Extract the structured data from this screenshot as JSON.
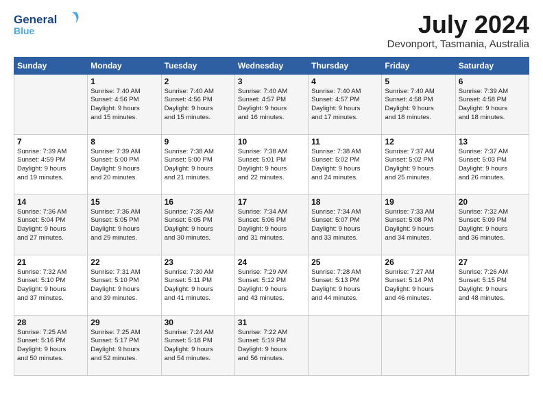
{
  "header": {
    "logo_general": "General",
    "logo_blue": "Blue",
    "title": "July 2024",
    "location": "Devonport, Tasmania, Australia"
  },
  "days_of_week": [
    "Sunday",
    "Monday",
    "Tuesday",
    "Wednesday",
    "Thursday",
    "Friday",
    "Saturday"
  ],
  "weeks": [
    [
      {
        "day": "",
        "lines": []
      },
      {
        "day": "1",
        "lines": [
          "Sunrise: 7:40 AM",
          "Sunset: 4:56 PM",
          "Daylight: 9 hours",
          "and 15 minutes."
        ]
      },
      {
        "day": "2",
        "lines": [
          "Sunrise: 7:40 AM",
          "Sunset: 4:56 PM",
          "Daylight: 9 hours",
          "and 15 minutes."
        ]
      },
      {
        "day": "3",
        "lines": [
          "Sunrise: 7:40 AM",
          "Sunset: 4:57 PM",
          "Daylight: 9 hours",
          "and 16 minutes."
        ]
      },
      {
        "day": "4",
        "lines": [
          "Sunrise: 7:40 AM",
          "Sunset: 4:57 PM",
          "Daylight: 9 hours",
          "and 17 minutes."
        ]
      },
      {
        "day": "5",
        "lines": [
          "Sunrise: 7:40 AM",
          "Sunset: 4:58 PM",
          "Daylight: 9 hours",
          "and 18 minutes."
        ]
      },
      {
        "day": "6",
        "lines": [
          "Sunrise: 7:39 AM",
          "Sunset: 4:58 PM",
          "Daylight: 9 hours",
          "and 18 minutes."
        ]
      }
    ],
    [
      {
        "day": "7",
        "lines": [
          "Sunrise: 7:39 AM",
          "Sunset: 4:59 PM",
          "Daylight: 9 hours",
          "and 19 minutes."
        ]
      },
      {
        "day": "8",
        "lines": [
          "Sunrise: 7:39 AM",
          "Sunset: 5:00 PM",
          "Daylight: 9 hours",
          "and 20 minutes."
        ]
      },
      {
        "day": "9",
        "lines": [
          "Sunrise: 7:38 AM",
          "Sunset: 5:00 PM",
          "Daylight: 9 hours",
          "and 21 minutes."
        ]
      },
      {
        "day": "10",
        "lines": [
          "Sunrise: 7:38 AM",
          "Sunset: 5:01 PM",
          "Daylight: 9 hours",
          "and 22 minutes."
        ]
      },
      {
        "day": "11",
        "lines": [
          "Sunrise: 7:38 AM",
          "Sunset: 5:02 PM",
          "Daylight: 9 hours",
          "and 24 minutes."
        ]
      },
      {
        "day": "12",
        "lines": [
          "Sunrise: 7:37 AM",
          "Sunset: 5:02 PM",
          "Daylight: 9 hours",
          "and 25 minutes."
        ]
      },
      {
        "day": "13",
        "lines": [
          "Sunrise: 7:37 AM",
          "Sunset: 5:03 PM",
          "Daylight: 9 hours",
          "and 26 minutes."
        ]
      }
    ],
    [
      {
        "day": "14",
        "lines": [
          "Sunrise: 7:36 AM",
          "Sunset: 5:04 PM",
          "Daylight: 9 hours",
          "and 27 minutes."
        ]
      },
      {
        "day": "15",
        "lines": [
          "Sunrise: 7:36 AM",
          "Sunset: 5:05 PM",
          "Daylight: 9 hours",
          "and 29 minutes."
        ]
      },
      {
        "day": "16",
        "lines": [
          "Sunrise: 7:35 AM",
          "Sunset: 5:05 PM",
          "Daylight: 9 hours",
          "and 30 minutes."
        ]
      },
      {
        "day": "17",
        "lines": [
          "Sunrise: 7:34 AM",
          "Sunset: 5:06 PM",
          "Daylight: 9 hours",
          "and 31 minutes."
        ]
      },
      {
        "day": "18",
        "lines": [
          "Sunrise: 7:34 AM",
          "Sunset: 5:07 PM",
          "Daylight: 9 hours",
          "and 33 minutes."
        ]
      },
      {
        "day": "19",
        "lines": [
          "Sunrise: 7:33 AM",
          "Sunset: 5:08 PM",
          "Daylight: 9 hours",
          "and 34 minutes."
        ]
      },
      {
        "day": "20",
        "lines": [
          "Sunrise: 7:32 AM",
          "Sunset: 5:09 PM",
          "Daylight: 9 hours",
          "and 36 minutes."
        ]
      }
    ],
    [
      {
        "day": "21",
        "lines": [
          "Sunrise: 7:32 AM",
          "Sunset: 5:10 PM",
          "Daylight: 9 hours",
          "and 37 minutes."
        ]
      },
      {
        "day": "22",
        "lines": [
          "Sunrise: 7:31 AM",
          "Sunset: 5:10 PM",
          "Daylight: 9 hours",
          "and 39 minutes."
        ]
      },
      {
        "day": "23",
        "lines": [
          "Sunrise: 7:30 AM",
          "Sunset: 5:11 PM",
          "Daylight: 9 hours",
          "and 41 minutes."
        ]
      },
      {
        "day": "24",
        "lines": [
          "Sunrise: 7:29 AM",
          "Sunset: 5:12 PM",
          "Daylight: 9 hours",
          "and 43 minutes."
        ]
      },
      {
        "day": "25",
        "lines": [
          "Sunrise: 7:28 AM",
          "Sunset: 5:13 PM",
          "Daylight: 9 hours",
          "and 44 minutes."
        ]
      },
      {
        "day": "26",
        "lines": [
          "Sunrise: 7:27 AM",
          "Sunset: 5:14 PM",
          "Daylight: 9 hours",
          "and 46 minutes."
        ]
      },
      {
        "day": "27",
        "lines": [
          "Sunrise: 7:26 AM",
          "Sunset: 5:15 PM",
          "Daylight: 9 hours",
          "and 48 minutes."
        ]
      }
    ],
    [
      {
        "day": "28",
        "lines": [
          "Sunrise: 7:25 AM",
          "Sunset: 5:16 PM",
          "Daylight: 9 hours",
          "and 50 minutes."
        ]
      },
      {
        "day": "29",
        "lines": [
          "Sunrise: 7:25 AM",
          "Sunset: 5:17 PM",
          "Daylight: 9 hours",
          "and 52 minutes."
        ]
      },
      {
        "day": "30",
        "lines": [
          "Sunrise: 7:24 AM",
          "Sunset: 5:18 PM",
          "Daylight: 9 hours",
          "and 54 minutes."
        ]
      },
      {
        "day": "31",
        "lines": [
          "Sunrise: 7:22 AM",
          "Sunset: 5:19 PM",
          "Daylight: 9 hours",
          "and 56 minutes."
        ]
      },
      {
        "day": "",
        "lines": []
      },
      {
        "day": "",
        "lines": []
      },
      {
        "day": "",
        "lines": []
      }
    ]
  ]
}
